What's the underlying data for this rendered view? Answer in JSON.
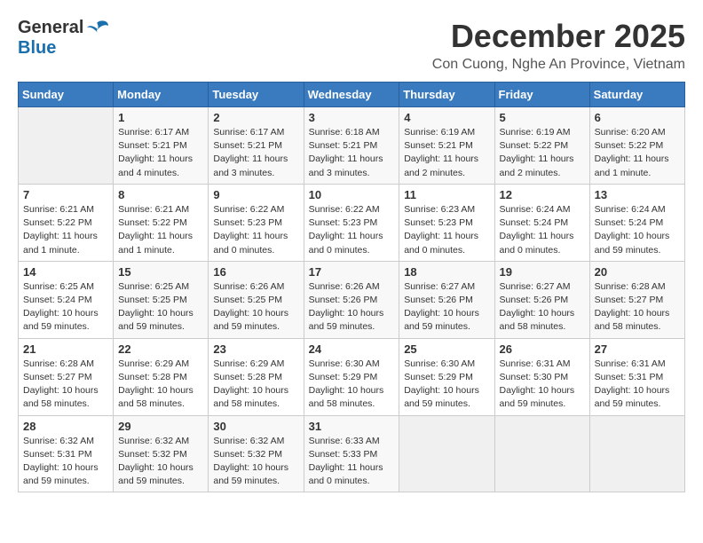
{
  "logo": {
    "general": "General",
    "blue": "Blue"
  },
  "title": "December 2025",
  "location": "Con Cuong, Nghe An Province, Vietnam",
  "headers": [
    "Sunday",
    "Monday",
    "Tuesday",
    "Wednesday",
    "Thursday",
    "Friday",
    "Saturday"
  ],
  "weeks": [
    [
      {
        "day": "",
        "info": ""
      },
      {
        "day": "1",
        "info": "Sunrise: 6:17 AM\nSunset: 5:21 PM\nDaylight: 11 hours\nand 4 minutes."
      },
      {
        "day": "2",
        "info": "Sunrise: 6:17 AM\nSunset: 5:21 PM\nDaylight: 11 hours\nand 3 minutes."
      },
      {
        "day": "3",
        "info": "Sunrise: 6:18 AM\nSunset: 5:21 PM\nDaylight: 11 hours\nand 3 minutes."
      },
      {
        "day": "4",
        "info": "Sunrise: 6:19 AM\nSunset: 5:21 PM\nDaylight: 11 hours\nand 2 minutes."
      },
      {
        "day": "5",
        "info": "Sunrise: 6:19 AM\nSunset: 5:22 PM\nDaylight: 11 hours\nand 2 minutes."
      },
      {
        "day": "6",
        "info": "Sunrise: 6:20 AM\nSunset: 5:22 PM\nDaylight: 11 hours\nand 1 minute."
      }
    ],
    [
      {
        "day": "7",
        "info": "Sunrise: 6:21 AM\nSunset: 5:22 PM\nDaylight: 11 hours\nand 1 minute."
      },
      {
        "day": "8",
        "info": "Sunrise: 6:21 AM\nSunset: 5:22 PM\nDaylight: 11 hours\nand 1 minute."
      },
      {
        "day": "9",
        "info": "Sunrise: 6:22 AM\nSunset: 5:23 PM\nDaylight: 11 hours\nand 0 minutes."
      },
      {
        "day": "10",
        "info": "Sunrise: 6:22 AM\nSunset: 5:23 PM\nDaylight: 11 hours\nand 0 minutes."
      },
      {
        "day": "11",
        "info": "Sunrise: 6:23 AM\nSunset: 5:23 PM\nDaylight: 11 hours\nand 0 minutes."
      },
      {
        "day": "12",
        "info": "Sunrise: 6:24 AM\nSunset: 5:24 PM\nDaylight: 11 hours\nand 0 minutes."
      },
      {
        "day": "13",
        "info": "Sunrise: 6:24 AM\nSunset: 5:24 PM\nDaylight: 10 hours\nand 59 minutes."
      }
    ],
    [
      {
        "day": "14",
        "info": "Sunrise: 6:25 AM\nSunset: 5:24 PM\nDaylight: 10 hours\nand 59 minutes."
      },
      {
        "day": "15",
        "info": "Sunrise: 6:25 AM\nSunset: 5:25 PM\nDaylight: 10 hours\nand 59 minutes."
      },
      {
        "day": "16",
        "info": "Sunrise: 6:26 AM\nSunset: 5:25 PM\nDaylight: 10 hours\nand 59 minutes."
      },
      {
        "day": "17",
        "info": "Sunrise: 6:26 AM\nSunset: 5:26 PM\nDaylight: 10 hours\nand 59 minutes."
      },
      {
        "day": "18",
        "info": "Sunrise: 6:27 AM\nSunset: 5:26 PM\nDaylight: 10 hours\nand 59 minutes."
      },
      {
        "day": "19",
        "info": "Sunrise: 6:27 AM\nSunset: 5:26 PM\nDaylight: 10 hours\nand 58 minutes."
      },
      {
        "day": "20",
        "info": "Sunrise: 6:28 AM\nSunset: 5:27 PM\nDaylight: 10 hours\nand 58 minutes."
      }
    ],
    [
      {
        "day": "21",
        "info": "Sunrise: 6:28 AM\nSunset: 5:27 PM\nDaylight: 10 hours\nand 58 minutes."
      },
      {
        "day": "22",
        "info": "Sunrise: 6:29 AM\nSunset: 5:28 PM\nDaylight: 10 hours\nand 58 minutes."
      },
      {
        "day": "23",
        "info": "Sunrise: 6:29 AM\nSunset: 5:28 PM\nDaylight: 10 hours\nand 58 minutes."
      },
      {
        "day": "24",
        "info": "Sunrise: 6:30 AM\nSunset: 5:29 PM\nDaylight: 10 hours\nand 58 minutes."
      },
      {
        "day": "25",
        "info": "Sunrise: 6:30 AM\nSunset: 5:29 PM\nDaylight: 10 hours\nand 59 minutes."
      },
      {
        "day": "26",
        "info": "Sunrise: 6:31 AM\nSunset: 5:30 PM\nDaylight: 10 hours\nand 59 minutes."
      },
      {
        "day": "27",
        "info": "Sunrise: 6:31 AM\nSunset: 5:31 PM\nDaylight: 10 hours\nand 59 minutes."
      }
    ],
    [
      {
        "day": "28",
        "info": "Sunrise: 6:32 AM\nSunset: 5:31 PM\nDaylight: 10 hours\nand 59 minutes."
      },
      {
        "day": "29",
        "info": "Sunrise: 6:32 AM\nSunset: 5:32 PM\nDaylight: 10 hours\nand 59 minutes."
      },
      {
        "day": "30",
        "info": "Sunrise: 6:32 AM\nSunset: 5:32 PM\nDaylight: 10 hours\nand 59 minutes."
      },
      {
        "day": "31",
        "info": "Sunrise: 6:33 AM\nSunset: 5:33 PM\nDaylight: 11 hours\nand 0 minutes."
      },
      {
        "day": "",
        "info": ""
      },
      {
        "day": "",
        "info": ""
      },
      {
        "day": "",
        "info": ""
      }
    ]
  ]
}
